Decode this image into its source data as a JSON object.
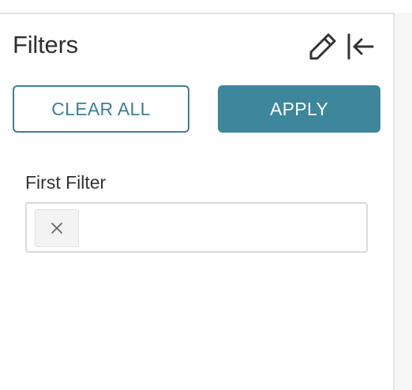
{
  "panel": {
    "title": "Filters",
    "edit_icon": "pencil-icon",
    "collapse_icon": "collapse-left-icon"
  },
  "actions": {
    "clear_all_label": "CLEAR ALL",
    "apply_label": "APPLY"
  },
  "filters": [
    {
      "label": "First Filter",
      "value": "",
      "clear_icon": "close-icon"
    }
  ],
  "colors": {
    "accent": "#3e869b",
    "accent_outline": "#3e7f98",
    "divider": "#e3e3e3",
    "input_border": "#d9d9d9"
  }
}
